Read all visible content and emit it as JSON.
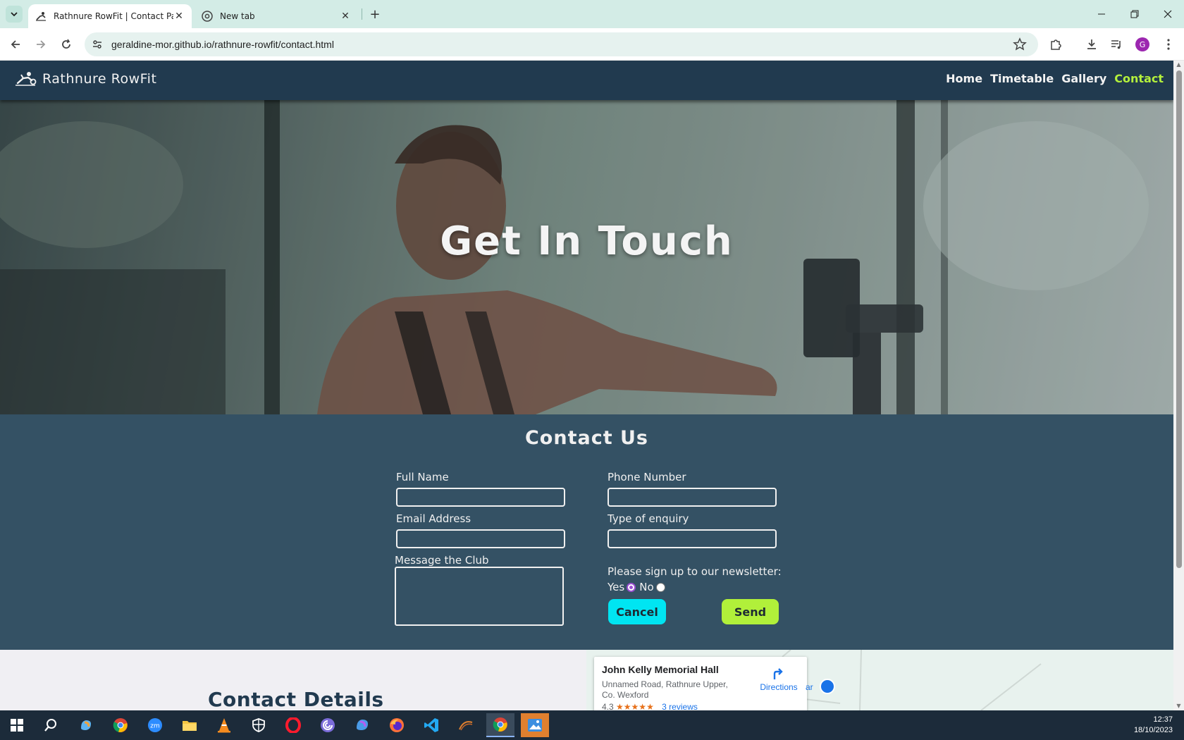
{
  "browser": {
    "tabs": [
      {
        "title": "Rathnure RowFit | Contact Page",
        "active": true
      },
      {
        "title": "New tab",
        "active": false
      }
    ],
    "url": "geraldine-mor.github.io/rathnure-rowfit/contact.html",
    "profile_initial": "G"
  },
  "site": {
    "brand": "Rathnure RowFit",
    "nav": [
      {
        "label": "Home",
        "active": false
      },
      {
        "label": "Timetable",
        "active": false
      },
      {
        "label": "Gallery",
        "active": false
      },
      {
        "label": "Contact",
        "active": true
      }
    ],
    "hero_title": "Get In Touch"
  },
  "contact_form": {
    "heading": "Contact Us",
    "full_name_label": "Full Name",
    "full_name_value": "",
    "phone_label": "Phone Number",
    "phone_value": "",
    "email_label": "Email Address",
    "email_value": "",
    "enquiry_label": "Type of enquiry",
    "enquiry_value": "",
    "message_label": "Message the Club",
    "message_value": "",
    "newsletter_label": "Please sign up to our newsletter:",
    "newsletter_yes": "Yes",
    "newsletter_no": "No",
    "newsletter_selected": "Yes",
    "cancel_label": "Cancel",
    "send_label": "Send"
  },
  "details": {
    "heading": "Contact Details"
  },
  "map": {
    "place": "John Kelly Memorial Hall",
    "address": "Unnamed Road, Rathnure Upper, Co. Wexford",
    "rating": "4.3",
    "stars": "★★★★★",
    "reviews": "3 reviews",
    "directions": "Directions",
    "pin_text": "ar"
  },
  "taskbar": {
    "time": "12:37",
    "date": "18/10/2023"
  },
  "colors": {
    "site_nav_bg": "#213a4f",
    "contact_bg": "#345164",
    "accent_green": "#b1f03a",
    "accent_cyan": "#00e5f2",
    "active_nav": "#b4f03c"
  }
}
